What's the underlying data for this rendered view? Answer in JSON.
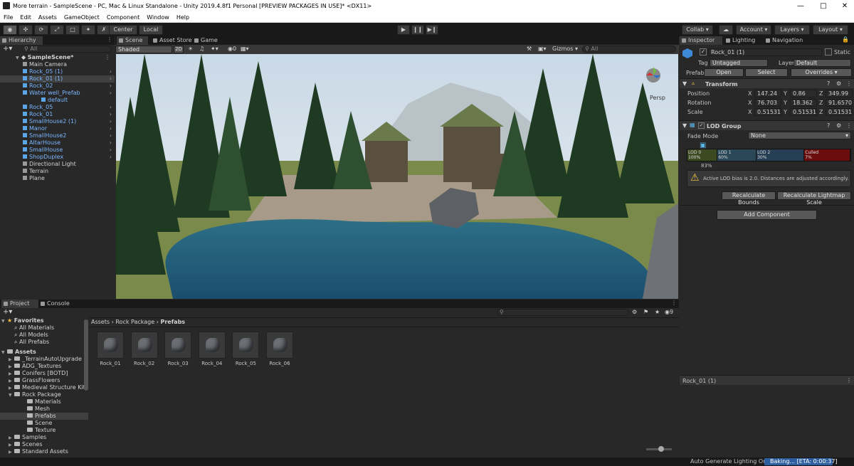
{
  "window": {
    "title": "More terrain - SampleScene - PC, Mac & Linux Standalone - Unity 2019.4.8f1 Personal [PREVIEW PACKAGES IN USE]* <DX11>"
  },
  "menu": [
    "File",
    "Edit",
    "Assets",
    "GameObject",
    "Component",
    "Window",
    "Help"
  ],
  "toolbar": {
    "pivot": "Center",
    "space": "Local",
    "collab": "Collab",
    "account": "Account",
    "layers": "Layers",
    "layout": "Layout"
  },
  "hierarchy": {
    "tab": "Hierarchy",
    "search_placeholder": "All",
    "scene": "SampleScene*",
    "items": [
      {
        "label": "Main Camera",
        "depth": 1,
        "prefab": false,
        "selected": false
      },
      {
        "label": "Rock_05 (1)",
        "depth": 1,
        "prefab": true,
        "selected": false
      },
      {
        "label": "Rock_01 (1)",
        "depth": 1,
        "prefab": true,
        "selected": true
      },
      {
        "label": "Rock_02",
        "depth": 1,
        "prefab": true,
        "selected": false
      },
      {
        "label": "Water well_Prefab",
        "depth": 1,
        "prefab": true,
        "selected": false
      },
      {
        "label": "default",
        "depth": 2,
        "prefab": true,
        "selected": false
      },
      {
        "label": "Rock_05",
        "depth": 1,
        "prefab": true,
        "selected": false
      },
      {
        "label": "Rock_01",
        "depth": 1,
        "prefab": true,
        "selected": false
      },
      {
        "label": "SmallHouse2 (1)",
        "depth": 1,
        "prefab": true,
        "selected": false
      },
      {
        "label": "Manor",
        "depth": 1,
        "prefab": true,
        "selected": false
      },
      {
        "label": "SmallHouse2",
        "depth": 1,
        "prefab": true,
        "selected": false
      },
      {
        "label": "AltarHouse",
        "depth": 1,
        "prefab": true,
        "selected": false
      },
      {
        "label": "SmallHouse",
        "depth": 1,
        "prefab": true,
        "selected": false
      },
      {
        "label": "ShopDuplex",
        "depth": 1,
        "prefab": true,
        "selected": false
      },
      {
        "label": "Directional Light",
        "depth": 1,
        "prefab": false,
        "selected": false
      },
      {
        "label": "Terrain",
        "depth": 1,
        "prefab": false,
        "selected": false
      },
      {
        "label": "Plane",
        "depth": 1,
        "prefab": false,
        "selected": false
      }
    ]
  },
  "scene_view": {
    "tabs": [
      "Scene",
      "Asset Store",
      "Game"
    ],
    "shading": "Shaded",
    "mode_2d": "2D",
    "gizmos": "Gizmos",
    "search_placeholder": "All",
    "persp": "Persp"
  },
  "project": {
    "tabs": [
      "Project",
      "Console"
    ],
    "favorites_label": "Favorites",
    "favorites": [
      "All Materials",
      "All Models",
      "All Prefabs"
    ],
    "assets_label": "Assets",
    "asset_folders": [
      {
        "label": "_TerrainAutoUpgrade",
        "depth": 1,
        "selected": false
      },
      {
        "label": "ADG_Textures",
        "depth": 1,
        "selected": false
      },
      {
        "label": "Conifers [BOTD]",
        "depth": 1,
        "selected": false
      },
      {
        "label": "GrassFlowers",
        "depth": 1,
        "selected": false
      },
      {
        "label": "Medieval Structure Kit",
        "depth": 1,
        "selected": false
      },
      {
        "label": "Rock Package",
        "depth": 1,
        "selected": false
      },
      {
        "label": "Materials",
        "depth": 2,
        "selected": false
      },
      {
        "label": "Mesh",
        "depth": 2,
        "selected": false
      },
      {
        "label": "Prefabs",
        "depth": 2,
        "selected": true
      },
      {
        "label": "Scene",
        "depth": 2,
        "selected": false
      },
      {
        "label": "Texture",
        "depth": 2,
        "selected": false
      },
      {
        "label": "Samples",
        "depth": 1,
        "selected": false
      },
      {
        "label": "Scenes",
        "depth": 1,
        "selected": false
      },
      {
        "label": "Standard Assets",
        "depth": 1,
        "selected": false
      }
    ],
    "breadcrumb": [
      "Assets",
      "Rock Package",
      "Prefabs"
    ],
    "items": [
      "Rock_01",
      "Rock_02",
      "Rock_03",
      "Rock_04",
      "Rock_05",
      "Rock_06"
    ],
    "hidden_count": "9"
  },
  "inspector": {
    "tabs": [
      "Inspector",
      "Lighting",
      "Navigation"
    ],
    "object_name": "Rock_01 (1)",
    "static_label": "Static",
    "tag_label": "Tag",
    "tag_value": "Untagged",
    "layer_label": "Layer",
    "layer_value": "Default",
    "prefab_label": "Prefab",
    "prefab_open": "Open",
    "prefab_select": "Select",
    "prefab_overrides": "Overrides",
    "transform": {
      "title": "Transform",
      "rows": [
        {
          "label": "Position",
          "x": "147.24",
          "y": "0.86",
          "z": "349.99"
        },
        {
          "label": "Rotation",
          "x": "76.703",
          "y": "18.362",
          "z": "91.65701"
        },
        {
          "label": "Scale",
          "x": "0.51531",
          "y": "0.51531",
          "z": "0.51531"
        }
      ]
    },
    "lod": {
      "title": "LOD Group",
      "fade_label": "Fade Mode",
      "fade_value": "None",
      "marker": "83%",
      "levels": [
        {
          "name": "LOD 0",
          "pct": "100%",
          "share": 0.17,
          "color": "#3c4a22"
        },
        {
          "name": "LOD 1",
          "pct": "60%",
          "share": 0.22,
          "color": "#2a4858"
        },
        {
          "name": "LOD 2",
          "pct": "30%",
          "share": 0.27,
          "color": "#273f55"
        },
        {
          "name": "Culled",
          "pct": "7%",
          "share": 0.26,
          "color": "#6b0d0d"
        }
      ],
      "warning": "Active LOD bias is 2.0. Distances are adjusted accordingly.",
      "recalc_bounds": "Recalculate Bounds",
      "recalc_lightmap": "Recalculate Lightmap Scale"
    },
    "add_component": "Add Component",
    "preview_name": "Rock_01 (1)"
  },
  "statusbar": {
    "auto_lighting": "Auto Generate Lighting On",
    "baking": "Baking... [ETA: 0:00:37]"
  },
  "colors": {
    "accent_blue": "#2d5e9f",
    "prefab_text": "#7ab7ff",
    "panel_bg": "#282828",
    "header_bg": "#191919"
  }
}
